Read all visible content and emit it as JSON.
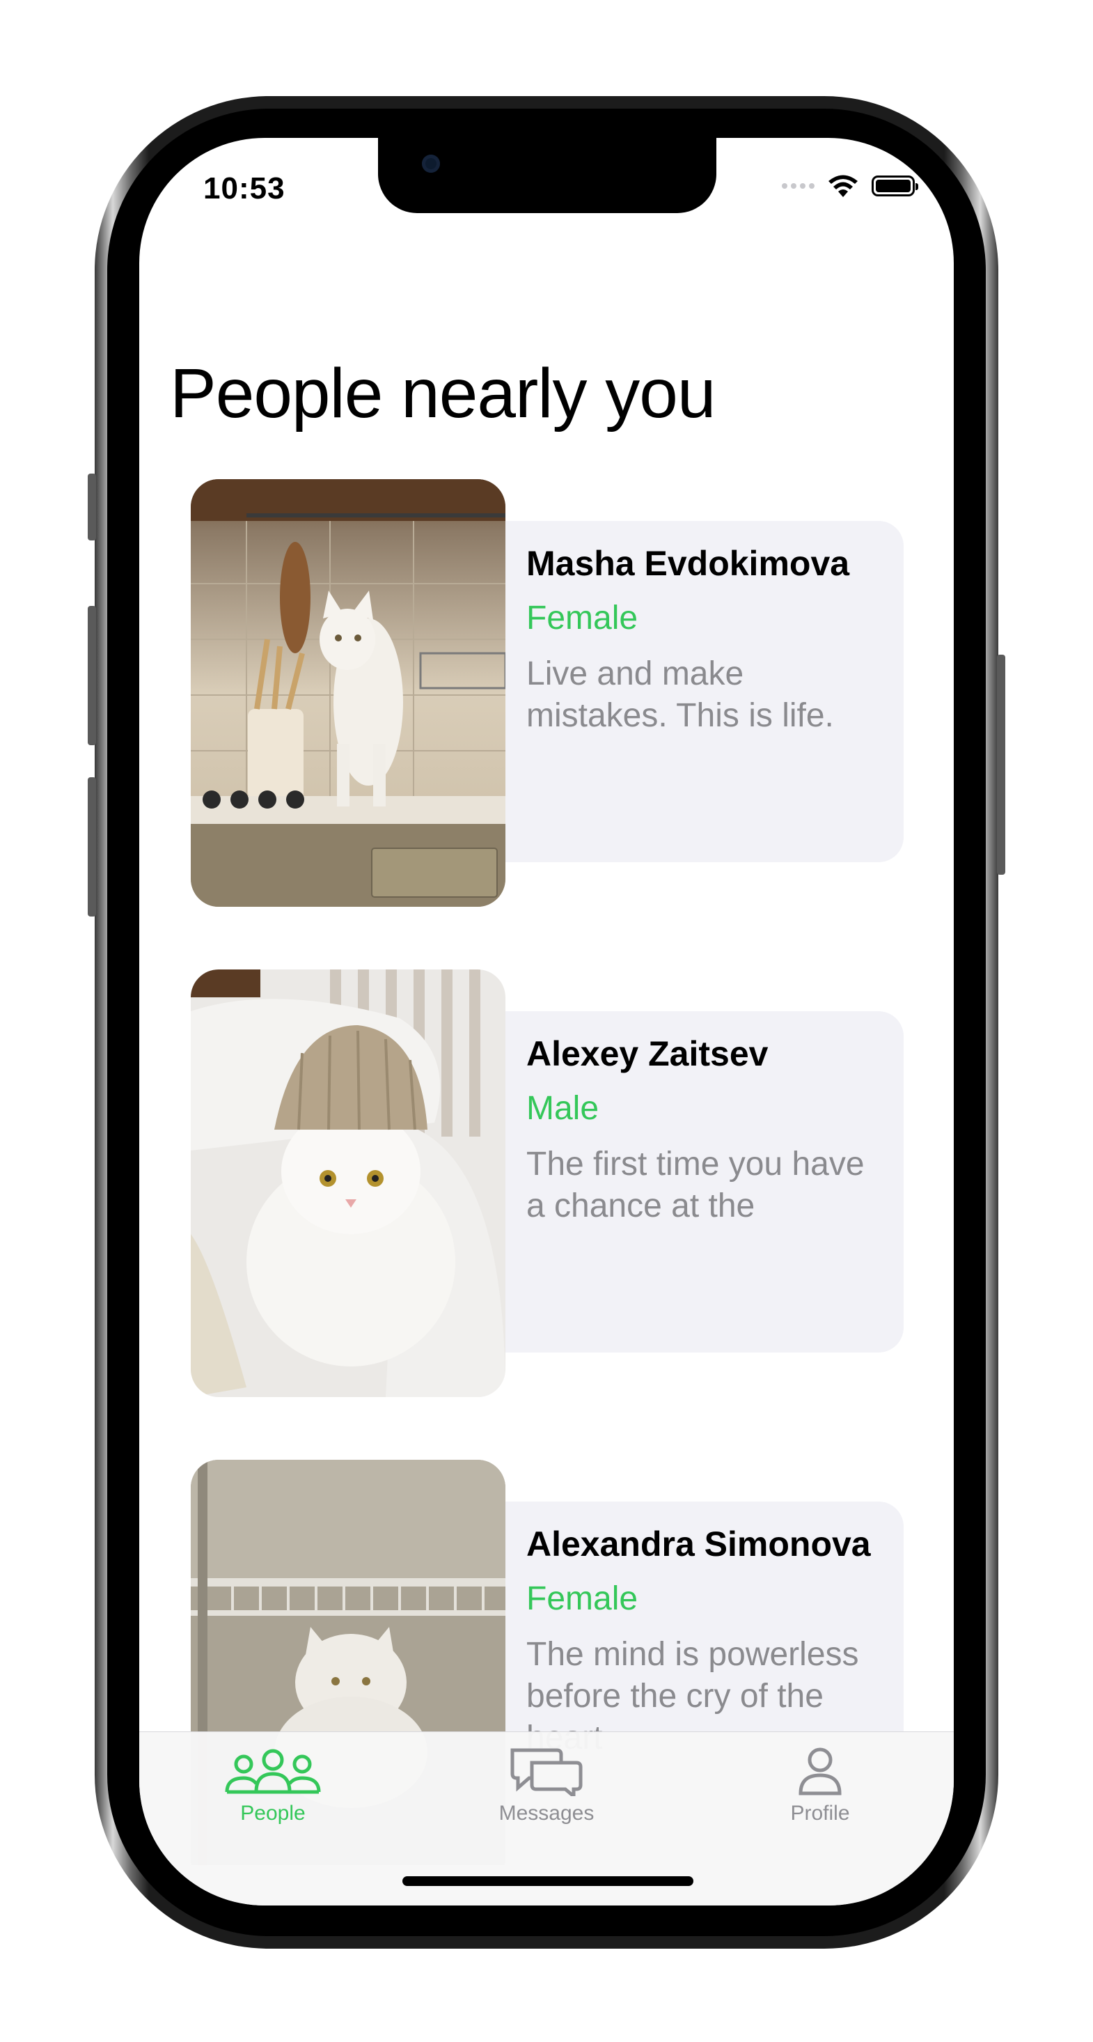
{
  "status_bar": {
    "time": "10:53"
  },
  "page": {
    "title": "People nearly you"
  },
  "people": [
    {
      "name": "Masha Evdokimova",
      "gender": "Female",
      "bio": "Live and make mistakes. This is life."
    },
    {
      "name": "Alexey Zaitsev",
      "gender": "Male",
      "bio": "The first time you have a chance at the"
    },
    {
      "name": "Alexandra Simonova",
      "gender": "Female",
      "bio": "The mind is powerless before the cry of the heart"
    }
  ],
  "tab_bar": {
    "tabs": [
      {
        "label": "People",
        "icon": "people-icon",
        "active": true
      },
      {
        "label": "Messages",
        "icon": "messages-icon",
        "active": false
      },
      {
        "label": "Profile",
        "icon": "profile-icon",
        "active": false
      }
    ]
  },
  "colors": {
    "accent": "#34c759",
    "card_background": "#f2f2f7",
    "secondary_text": "#8a8a8e",
    "tab_inactive": "#8e8e93"
  }
}
